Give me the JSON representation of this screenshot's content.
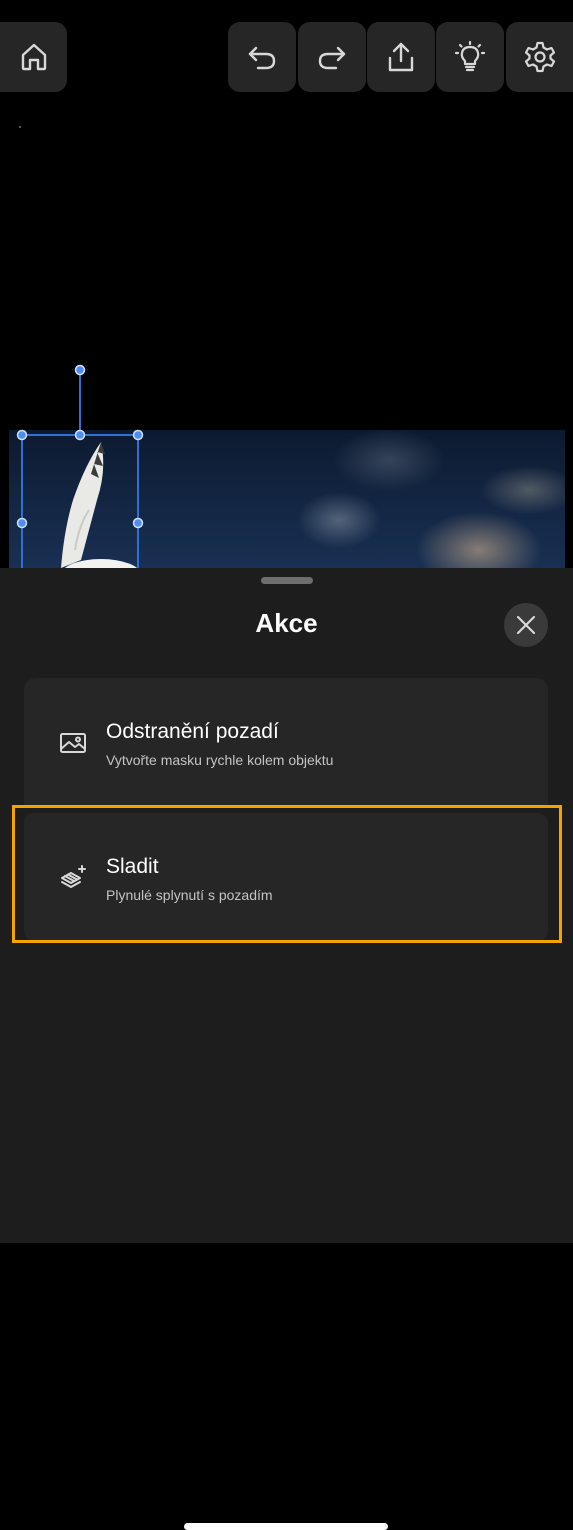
{
  "toolbar": {
    "icons": [
      "home-icon",
      "undo-icon",
      "redo-icon",
      "share-icon",
      "lightbulb-icon",
      "gear-icon"
    ]
  },
  "sheet": {
    "title": "Akce",
    "actions": [
      {
        "icon": "image-icon",
        "title": "Odstranění pozadí",
        "subtitle": "Vytvořte masku rychle kolem objektu"
      },
      {
        "icon": "blend-sparkle-icon",
        "title": "Sladit",
        "subtitle": "Plynulé splynutí s pozadím",
        "highlighted": true
      }
    ]
  },
  "colors": {
    "highlight": "#f5a300",
    "selection": "#2f6fd6",
    "sheet_bg": "#1d1d1d"
  }
}
